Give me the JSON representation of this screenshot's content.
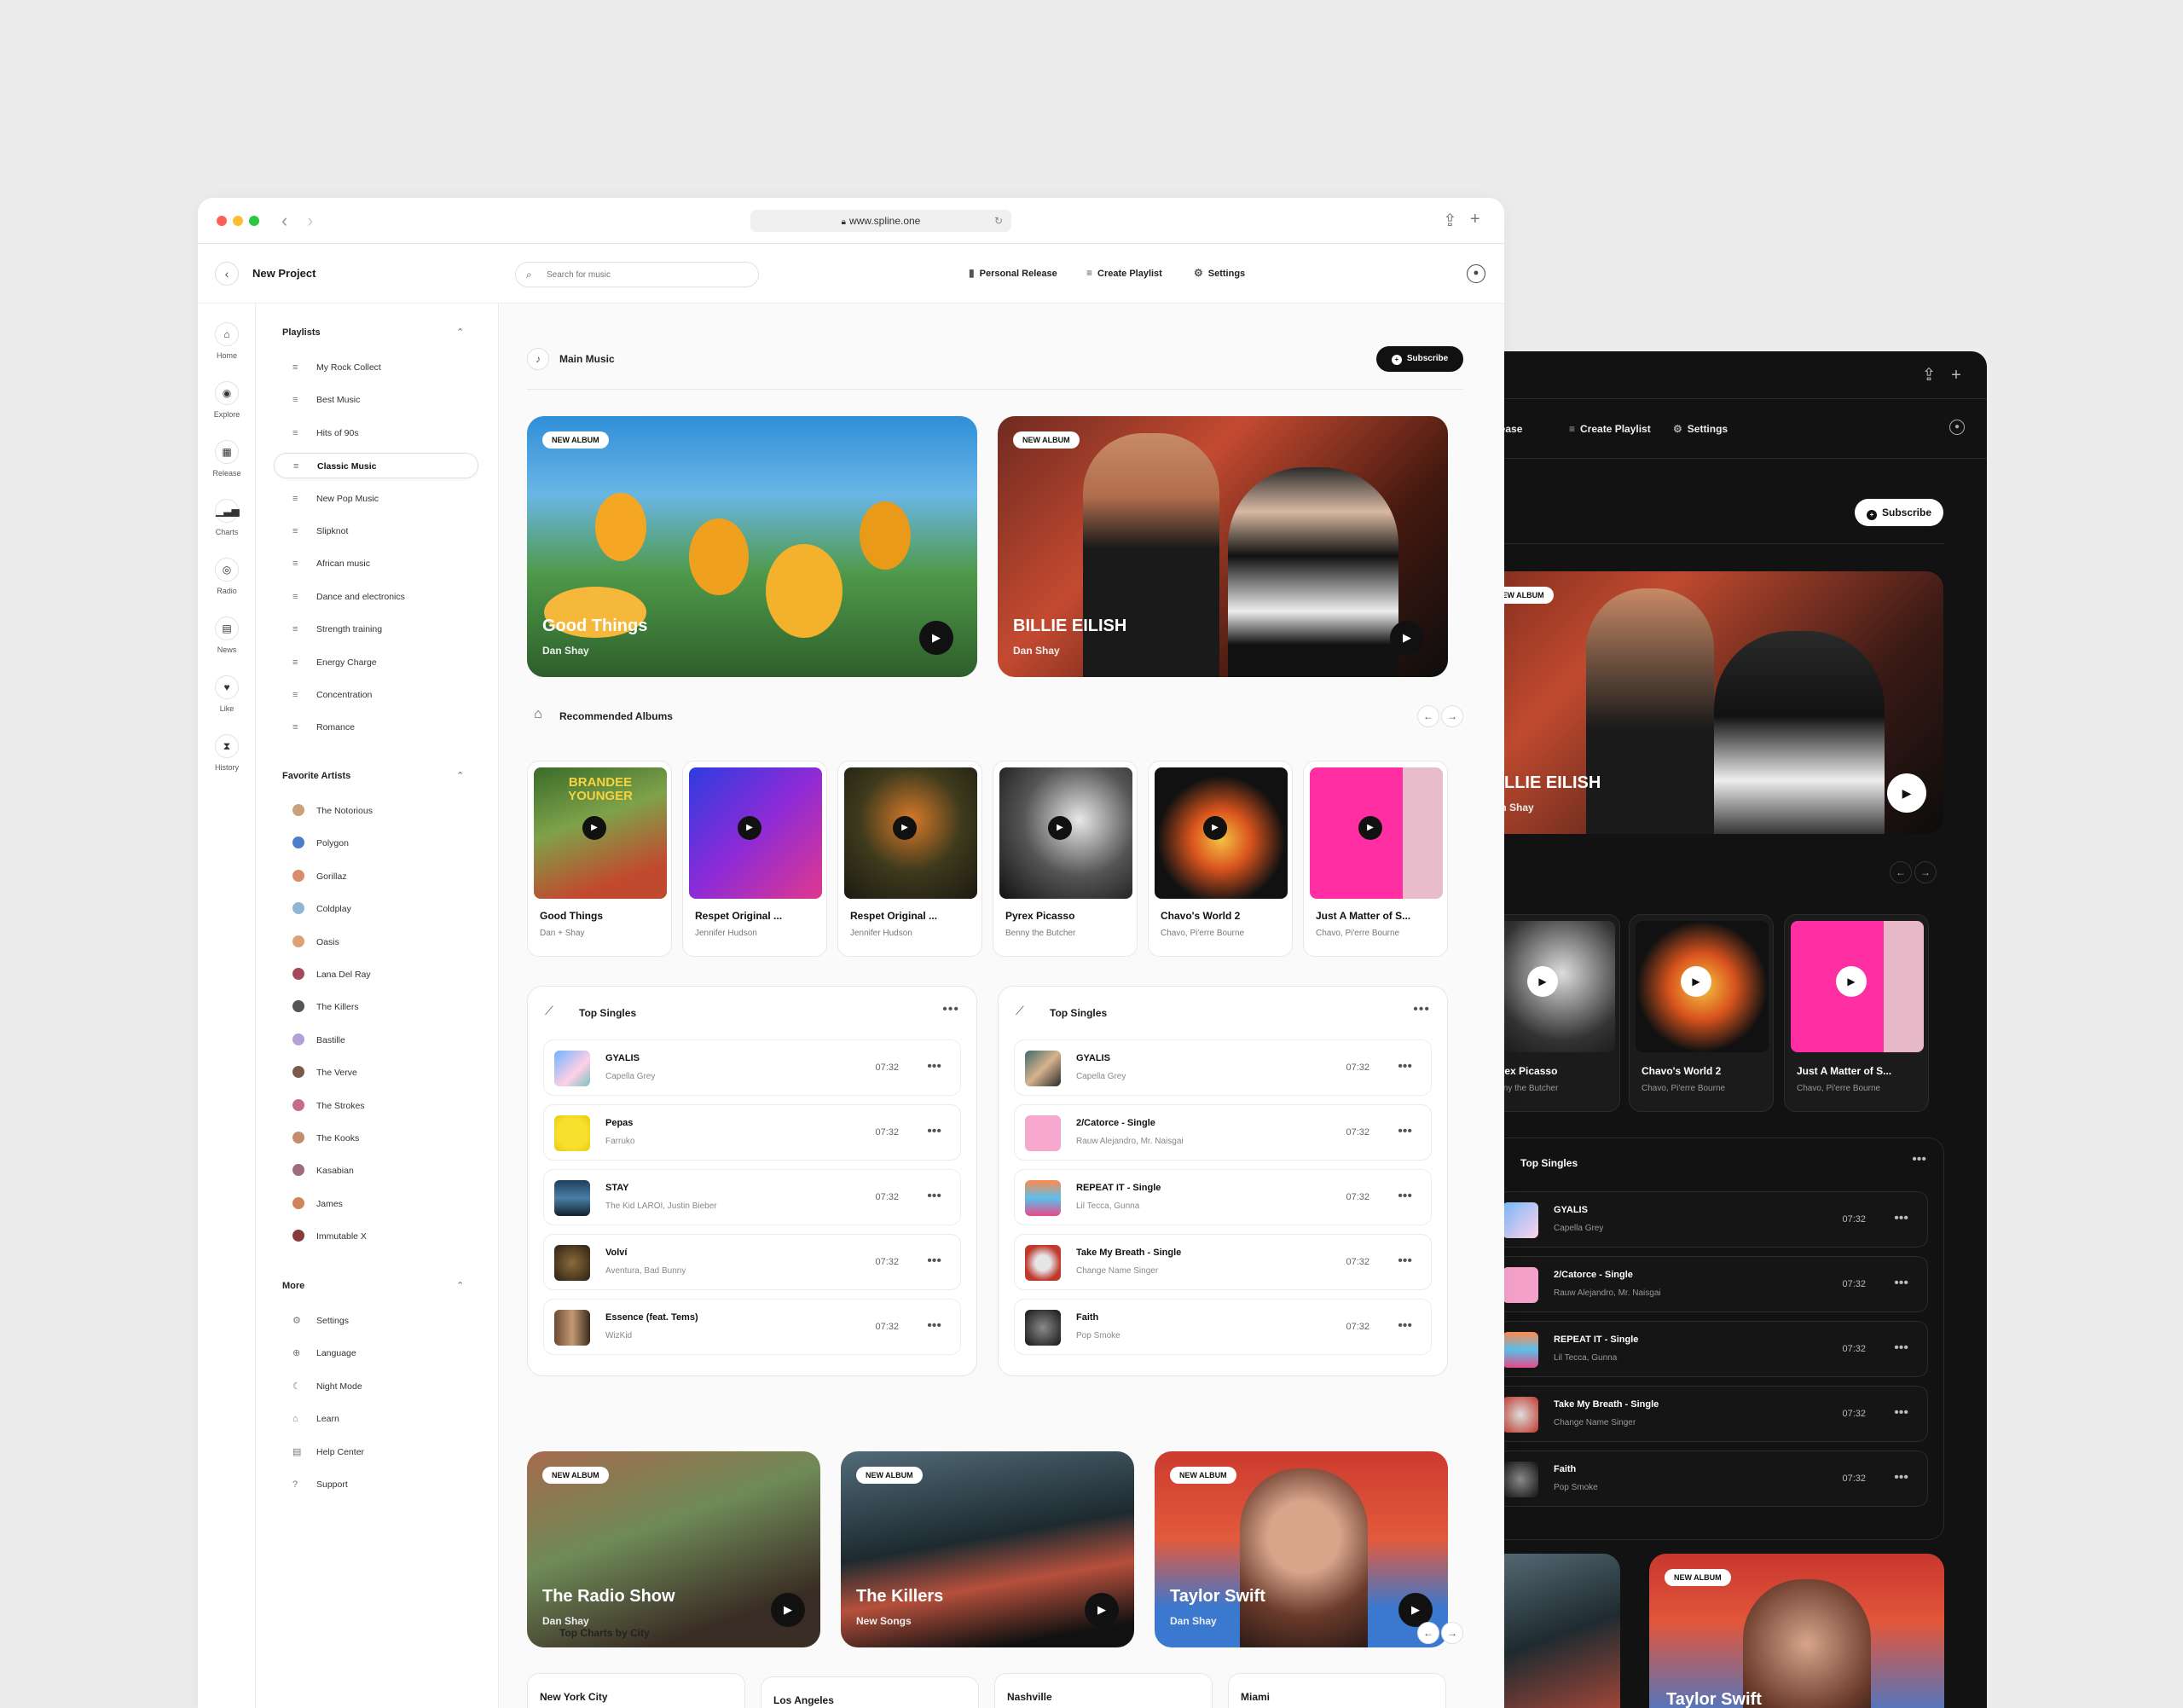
{
  "browser": {
    "url": "www.spline.one",
    "colors": {
      "close": "#ff5f57",
      "minimize": "#febc2e",
      "maximize": "#28c840"
    }
  },
  "appbar": {
    "project_title": "New Project",
    "search_placeholder": "Search for music",
    "nav": [
      {
        "icon": "bookmark-icon",
        "label": "Personal Release"
      },
      {
        "icon": "playlist-add-icon",
        "label": "Create Playlist"
      },
      {
        "icon": "gear-icon",
        "label": "Settings"
      }
    ]
  },
  "rail": [
    {
      "icon": "home-icon",
      "label": "Home"
    },
    {
      "icon": "compass-icon",
      "label": "Explore"
    },
    {
      "icon": "calendar-icon",
      "label": "Release"
    },
    {
      "icon": "bar-chart-icon",
      "label": "Charts"
    },
    {
      "icon": "radio-icon",
      "label": "Radio"
    },
    {
      "icon": "news-icon",
      "label": "News"
    },
    {
      "icon": "heart-icon",
      "label": "Like"
    },
    {
      "icon": "hourglass-icon",
      "label": "History"
    }
  ],
  "sidebar": {
    "playlists_title": "Playlists",
    "playlists": [
      "My Rock Collect",
      "Best Music",
      "Hits of 90s",
      "Classic Music",
      "New Pop Music",
      "Slipknot",
      "African music",
      "Dance and electronics",
      "Strength training",
      "Energy Charge",
      "Concentration",
      "Romance"
    ],
    "active_playlist": "Classic Music",
    "artists_title": "Favorite Artists",
    "artists": [
      "The Notorious",
      "Polygon",
      "Gorillaz",
      "Coldplay",
      "Oasis",
      "Lana Del Ray",
      "The Killers",
      "Bastille",
      "The Verve",
      "The Strokes",
      "The Kooks",
      "Kasabian",
      "James",
      "Immutable X"
    ],
    "more_title": "More",
    "more": [
      {
        "icon": "gear-icon",
        "label": "Settings"
      },
      {
        "icon": "globe-icon",
        "label": "Language"
      },
      {
        "icon": "moon-icon",
        "label": "Night Mode"
      },
      {
        "icon": "graduation-cap-icon",
        "label": "Learn"
      },
      {
        "icon": "document-icon",
        "label": "Help Center"
      },
      {
        "icon": "question-icon",
        "label": "Support"
      }
    ]
  },
  "main": {
    "section_title": "Main Music",
    "subscribe_label": "Subscribe",
    "heroes": [
      {
        "badge": "NEW ALBUM",
        "title": "Good Things",
        "artist": "Dan Shay"
      },
      {
        "badge": "NEW ALBUM",
        "title": "BILLIE EILISH",
        "artist": "Dan Shay"
      }
    ],
    "recommended_title": "Recommended Albums",
    "albums": [
      {
        "title": "Good Things",
        "artist": "Dan + Shay"
      },
      {
        "title": "Respet Original ...",
        "artist": "Jennifer Hudson"
      },
      {
        "title": "Respet Original ...",
        "artist": "Jennifer Hudson"
      },
      {
        "title": "Pyrex Picasso",
        "artist": "Benny the Butcher"
      },
      {
        "title": "Chavo's World 2",
        "artist": "Chavo, Pi'erre Bourne"
      },
      {
        "title": "Just A Matter of S...",
        "artist": "Chavo, Pi'erre Bourne"
      }
    ],
    "singles_left": {
      "title": "Top Singles",
      "tracks": [
        {
          "title": "GYALIS",
          "artist": "Capella Grey",
          "duration": "07:32"
        },
        {
          "title": "Pepas",
          "artist": "Farruko",
          "duration": "07:32"
        },
        {
          "title": "STAY",
          "artist": "The Kid LAROI, Justin Bieber",
          "duration": "07:32"
        },
        {
          "title": "Volví",
          "artist": "Aventura, Bad Bunny",
          "duration": "07:32"
        },
        {
          "title": "Essence (feat. Tems)",
          "artist": "WizKid",
          "duration": "07:32"
        }
      ]
    },
    "singles_right": {
      "title": "Top Singles",
      "tracks": [
        {
          "title": "GYALIS",
          "artist": "Capella Grey",
          "duration": "07:32"
        },
        {
          "title": "2/Catorce - Single",
          "artist": "Rauw Alejandro, Mr. Naisgai",
          "duration": "07:32"
        },
        {
          "title": "REPEAT IT - Single",
          "artist": "Lil Tecca, Gunna",
          "duration": "07:32"
        },
        {
          "title": "Take My Breath - Single",
          "artist": "Change Name Singer",
          "duration": "07:32"
        },
        {
          "title": "Faith",
          "artist": "Pop Smoke",
          "duration": "07:32"
        }
      ]
    },
    "banners": [
      {
        "badge": "NEW ALBUM",
        "title": "The Radio Show",
        "artist": "Dan Shay"
      },
      {
        "badge": "NEW ALBUM",
        "title": "The Killers",
        "artist": "New Songs"
      },
      {
        "badge": "NEW ALBUM",
        "title": "Taylor Swift",
        "artist": "Dan Shay"
      }
    ],
    "cities_title": "Top Charts by City",
    "cities": [
      "New York City",
      "Los Angeles",
      "Nashville",
      "Miami"
    ]
  },
  "dark": {
    "nav": [
      "Release",
      "Create Playlist",
      "Settings"
    ],
    "subscribe_label": "Subscribe",
    "hero": {
      "badge": "NEW ALBUM",
      "title": "BILLIE EILISH",
      "artist": "Dan Shay"
    },
    "albums": [
      {
        "title": "Pyrex Picasso",
        "artist": "Benny the Butcher"
      },
      {
        "title": "Chavo's World 2",
        "artist": "Chavo, Pi'erre Bourne"
      },
      {
        "title": "Just A Matter of S...",
        "artist": "Chavo, Pi'erre Bourne"
      }
    ],
    "singles_title": "Top Singles",
    "tracks": [
      {
        "title": "GYALIS",
        "artist": "Capella Grey",
        "duration": "07:32"
      },
      {
        "title": "2/Catorce - Single",
        "artist": "Rauw Alejandro, Mr. Naisgai",
        "duration": "07:32"
      },
      {
        "title": "REPEAT IT - Single",
        "artist": "Lil Tecca, Gunna",
        "duration": "07:32"
      },
      {
        "title": "Take My Breath - Single",
        "artist": "Change Name Singer",
        "duration": "07:32"
      },
      {
        "title": "Faith",
        "artist": "Pop Smoke",
        "duration": "07:32"
      }
    ],
    "banner": {
      "badge": "NEW ALBUM",
      "title": "Taylor Swift"
    }
  }
}
